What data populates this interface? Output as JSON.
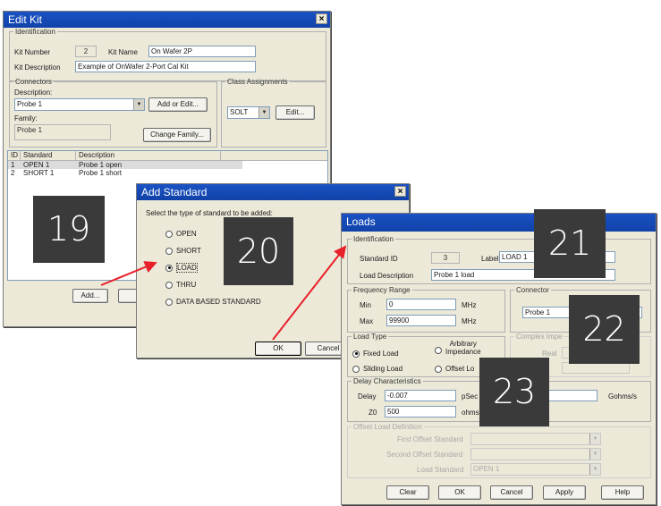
{
  "edit_kit": {
    "title": "Edit Kit",
    "identification_legend": "Identification",
    "kit_number_label": "Kit Number",
    "kit_number_value": "2",
    "kit_name_label": "Kit Name",
    "kit_name_value": "On Wafer 2P",
    "kit_description_label": "Kit Description",
    "kit_description_value": "Example of OnWafer 2-Port Cal Kit",
    "connectors_legend": "Connectors",
    "description_label": "Description:",
    "description_value": "Probe 1",
    "add_or_edit_label": "Add or Edit...",
    "family_label": "Family:",
    "family_value": "Probe 1",
    "change_family_label": "Change Family...",
    "class_assignments_legend": "Class Assignments",
    "class_value": "SOLT",
    "edit_label": "Edit...",
    "table_headers": [
      "ID",
      "Standard",
      "Description"
    ],
    "table_rows": [
      {
        "id": "1",
        "standard": "OPEN 1",
        "description": "Probe 1 open"
      },
      {
        "id": "2",
        "standard": "SHORT 1",
        "description": "Probe 1 short"
      }
    ],
    "add_label": "Add..."
  },
  "add_standard": {
    "title": "Add Standard",
    "prompt": "Select the type of standard to be added:",
    "options": [
      "OPEN",
      "SHORT",
      "LOAD",
      "THRU",
      "DATA BASED STANDARD"
    ],
    "selected": "LOAD",
    "ok_label": "OK",
    "cancel_label": "Cancel"
  },
  "loads": {
    "title": "Loads",
    "identification_legend": "Identification",
    "standard_id_label": "Standard ID",
    "standard_id_value": "3",
    "label_label": "Label",
    "label_value": "LOAD 1",
    "load_description_label": "Load Description",
    "load_description_value": "Probe 1  load",
    "frequency_range_legend": "Frequency Range",
    "min_label": "Min",
    "min_value": "0",
    "max_label": "Max",
    "max_value": "99900",
    "mhz_unit": "MHz",
    "connector_legend": "Connector",
    "connector_value": "Probe 1",
    "load_type_legend": "Load Type",
    "fixed_load": "Fixed Load",
    "sliding_load": "Sliding Load",
    "arbitrary_impedance": "Arbitrary\nImpedance",
    "offset_load": "Offset Lo",
    "complex_impedance_legend": "Complex Impe",
    "real_label": "Real",
    "delay_characteristics_legend": "Delay Characteristics",
    "delay_label": "Delay",
    "delay_value": "-0.007",
    "delay_unit": "pSec",
    "z0_label": "Z0",
    "z0_value": "500",
    "z0_unit": "ohms",
    "gohms_unit": "Gohms/s",
    "offset_load_definition_legend": "Offset Load Definition",
    "first_offset_label": "First Offset Standard",
    "second_offset_label": "Second Offset Standard",
    "load_standard_label": "Load Standard",
    "load_standard_value": "OPEN 1",
    "clear_label": "Clear",
    "ok_label": "OK",
    "cancel_label": "Cancel",
    "apply_label": "Apply",
    "help_label": "Help"
  },
  "callouts": [
    "19",
    "20",
    "21",
    "22",
    "23"
  ],
  "colors": {
    "titlebar": "#1a52c4",
    "arrow": "#e8202a",
    "badge": "#3a3a3a"
  }
}
